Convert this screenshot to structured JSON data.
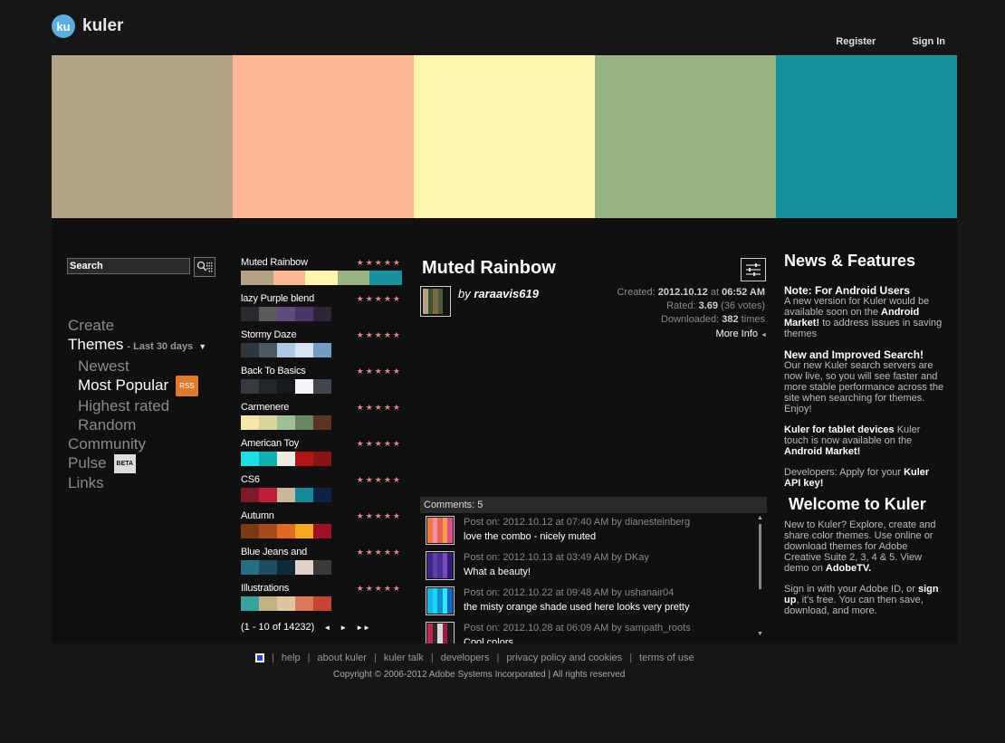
{
  "brand": {
    "badge": "ku",
    "name": "kuler"
  },
  "topnav": {
    "register": "Register",
    "signin": "Sign In"
  },
  "hero": {
    "colors": [
      "#b2a386",
      "#ffb893",
      "#fff6ae",
      "#9ab385",
      "#1591a0"
    ]
  },
  "search": {
    "placeholder": "Search"
  },
  "nav": {
    "create": "Create",
    "themes": "Themes",
    "themes_filter": "- Last 30 days",
    "newest": "Newest",
    "most_popular": "Most Popular",
    "rss": "RSS",
    "highest_rated": "Highest rated",
    "random": "Random",
    "community": "Community",
    "pulse": "Pulse",
    "beta": "BETA",
    "links": "Links"
  },
  "themes": [
    {
      "name": "Muted Rainbow",
      "stars": "★★★★★",
      "colors": [
        "#b2a386",
        "#ffb893",
        "#fff6ae",
        "#9ab385",
        "#1591a0"
      ]
    },
    {
      "name": "lazy Purple blend",
      "stars": "★★★★★",
      "colors": [
        "#2c2a2e",
        "#5b5a5c",
        "#5f4b7a",
        "#4a3568",
        "#2d2535"
      ]
    },
    {
      "name": "Stormy Daze",
      "stars": "★★★★★",
      "colors": [
        "#2f363c",
        "#4c5a5e",
        "#aec9e3",
        "#d4e3f1",
        "#729dc2"
      ]
    },
    {
      "name": "Back To Basics",
      "stars": "★★★★★",
      "colors": [
        "#343a3e",
        "#232629",
        "#181b1d",
        "#f2f4f8",
        "#41464d"
      ]
    },
    {
      "name": "Carmenere",
      "stars": "★★★★★",
      "colors": [
        "#f4e6a8",
        "#d9d49c",
        "#9dbf95",
        "#6c8565",
        "#5a3424"
      ]
    },
    {
      "name": "American Toy",
      "stars": "★★★★★",
      "colors": [
        "#16e3e8",
        "#12b0b0",
        "#ecede0",
        "#b01616",
        "#8a1412"
      ]
    },
    {
      "name": "CS6",
      "stars": "★★★★★",
      "colors": [
        "#7d1a29",
        "#c21c3a",
        "#c8b89a",
        "#128a98",
        "#0e2243"
      ]
    },
    {
      "name": "Autumn",
      "stars": "★★★★★",
      "colors": [
        "#7a3a14",
        "#a84a1c",
        "#e06a20",
        "#f3a81e",
        "#a01024"
      ]
    },
    {
      "name": "Blue Jeans and",
      "stars": "★★★★★",
      "colors": [
        "#266e82",
        "#1d4d5e",
        "#0f2a35",
        "#e0d4c8",
        "#3a3a3a"
      ]
    },
    {
      "name": "Illustrations",
      "stars": "★★★★★",
      "colors": [
        "#38a39e",
        "#bfb482",
        "#dcc5a0",
        "#d97a5a",
        "#c64532"
      ]
    }
  ],
  "pager": {
    "label": "(1 - 10 of 14232)",
    "prev": "◄",
    "next": "►",
    "last": "►►"
  },
  "detail": {
    "title": "Muted Rainbow",
    "by": "by",
    "author": "raraavis619",
    "thumb_colors": [
      "#b2a386",
      "#3e5530",
      "#7b6a45",
      "#4b5b3c",
      "#111111"
    ],
    "created_label": "Created:",
    "created_date": "2012.10.12",
    "created_at": "at",
    "created_time": "06:52 AM",
    "rated_label": "Rated:",
    "rated_value": "3.69",
    "rated_votes": "(36 votes)",
    "downloaded_label": "Downloaded:",
    "downloaded_value": "382",
    "downloaded_unit": "times",
    "more_info": "More Info"
  },
  "comments": {
    "header": "Comments: 5",
    "items": [
      {
        "post": "Post on: 2012.10.12 at 07:40 AM by dianesteinberg",
        "text": "love the combo - nicely muted",
        "colors": [
          "#f07a3a",
          "#f58fa4",
          "#e8664f",
          "#f2a14d",
          "#e24d8e"
        ]
      },
      {
        "post": "Post on: 2012.10.13 at 03:49 AM by DKay",
        "text": "What a beauty!",
        "colors": [
          "#3a2a86",
          "#5b3fa8",
          "#4a2f9a",
          "#7a47bd",
          "#2b1f6f"
        ]
      },
      {
        "post": "Post on: 2012.10.22 at 09:48 AM by ushanair04",
        "text": "the misty orange shade used here looks very pretty",
        "colors": [
          "#1ab2e8",
          "#18d4f2",
          "#0f8fd0",
          "#30e8f8",
          "#1068c4"
        ]
      },
      {
        "post": "Post on: 2012.10.28 at 06:09 AM by sampath_roots",
        "text": "Cool colors",
        "colors": [
          "#c02850",
          "#2a2a2a",
          "#d8d8d8",
          "#9a2040",
          "#1a1a1a"
        ]
      }
    ]
  },
  "news": {
    "title": "News & Features",
    "android_title": "Note: For Android Users",
    "android_t1": "A new version for Kuler would be available soon on the",
    "android_link": "Android Market!",
    "android_t2": "to address issues in saving themes",
    "search_title": "New and Improved Search!",
    "search_text": "Our new Kuler search servers are now live, so you will see faster and more stable performance across the site when searching for themes.  Enjoy!",
    "tablet_title": "Kuler for tablet devices",
    "tablet_text": "Kuler touch is now available on the",
    "tablet_link": "Android Market!",
    "dev_text": "Developers: Apply for your",
    "dev_link": "Kuler API key!",
    "welcome_title": "Welcome to Kuler",
    "welcome_text": "New to Kuler? Explore, create and share color themes. Use online or download themes for Adobe Creative Suite 2, 3, 4 & 5. View demo on",
    "welcome_link": "AdobeTV.",
    "signin_t1": "Sign in with your Adobe ID, or",
    "signin_link": "sign up",
    "signin_t2": ", it's free. You can then save, download, and more."
  },
  "footer": {
    "links": [
      "help",
      "about kuler",
      "kuler talk",
      "developers",
      "privacy policy and cookies",
      "terms of use"
    ],
    "copyright": "Copyright © 2006-2012 Adobe Systems Incorporated | All rights reserved"
  }
}
